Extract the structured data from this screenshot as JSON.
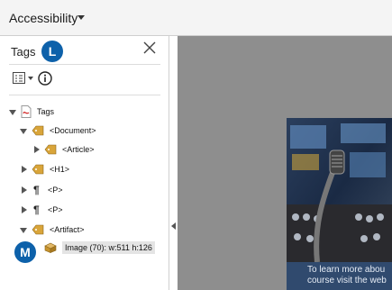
{
  "topbar": {
    "title": "Accessibility"
  },
  "panel": {
    "title": "Tags",
    "badge_l": "L",
    "badge_m": "M"
  },
  "tree": {
    "root": "Tags",
    "document": "<Document>",
    "article": "<Article>",
    "h1": "<H1>",
    "p1": "<P>",
    "p2": "<P>",
    "artifact": "<Artifact>",
    "image": "Image (70): w:511 h:126"
  },
  "viewer": {
    "caption_line1": "To learn more abou",
    "caption_line2": "course visit the web"
  },
  "colors": {
    "badge": "#0d61aa",
    "viewer_bg": "#8e8e8e",
    "caption_bg": "#304a6e"
  }
}
